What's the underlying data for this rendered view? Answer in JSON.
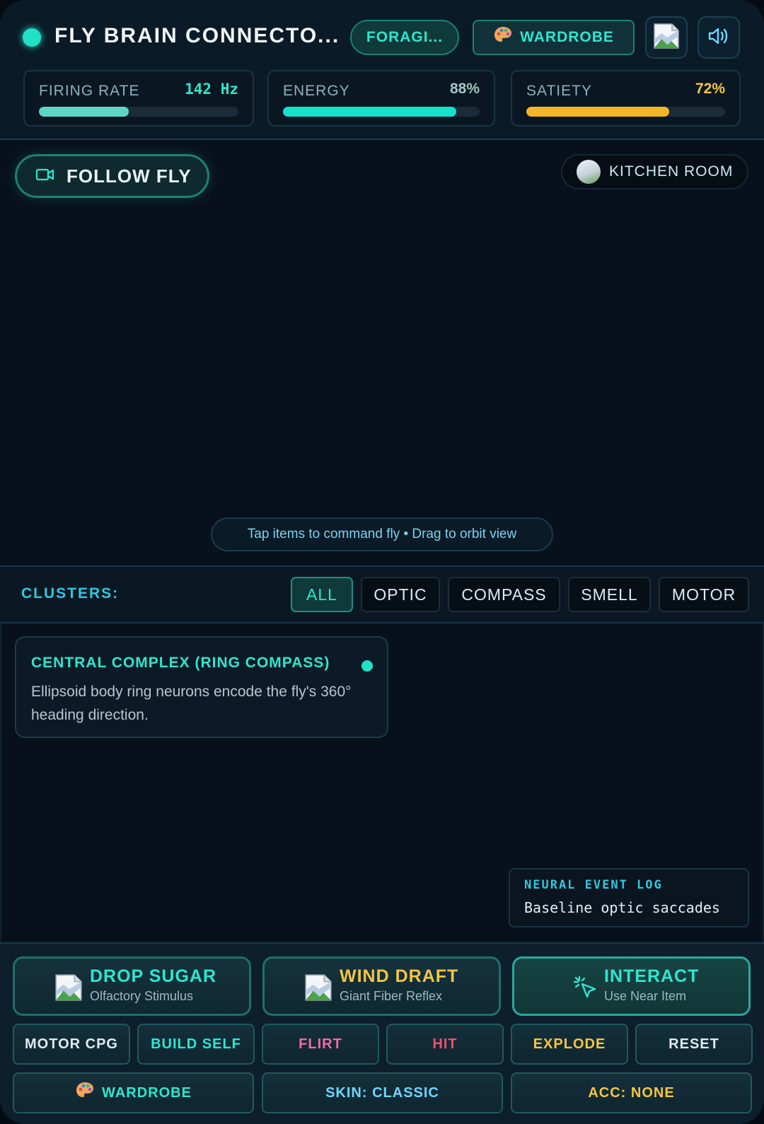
{
  "header": {
    "title": "FLY BRAIN CONNECTO...",
    "mode_label": "FORAGI...",
    "wardrobe_label": "WARDROBE",
    "icons": [
      "palette-icon",
      "image-placeholder-icon",
      "speaker-icon"
    ]
  },
  "stats": [
    {
      "label": "FIRING RATE",
      "value": "142 Hz",
      "level": 0.45,
      "color": "#5fd6c4"
    },
    {
      "label": "ENERGY",
      "value": "88%",
      "level": 0.88,
      "color": "#16e2cc"
    },
    {
      "label": "SATIETY",
      "value": "72%",
      "level": 0.72,
      "color": "#f4b527"
    }
  ],
  "viewport": {
    "follow_label": "FOLLOW FLY",
    "room_label": "KITCHEN ROOM",
    "hint": "Tap items to command fly • Drag to orbit view"
  },
  "clusters": {
    "label": "CLUSTERS:",
    "tabs": [
      "ALL",
      "OPTIC",
      "COMPASS",
      "SMELL",
      "MOTOR"
    ],
    "active": "ALL"
  },
  "info": {
    "title": "CENTRAL COMPLEX (RING COMPASS)",
    "description": "Ellipsoid body ring neurons encode the fly's 360° heading direction."
  },
  "log": {
    "title": "NEURAL EVENT LOG",
    "line": "Baseline optic saccades"
  },
  "actions": {
    "primary": [
      {
        "title": "DROP SUGAR",
        "subtitle": "Olfactory Stimulus",
        "color": "#2ee6cf"
      },
      {
        "title": "WIND DRAFT",
        "subtitle": "Giant Fiber Reflex",
        "color": "#f4c542"
      },
      {
        "title": "INTERACT",
        "subtitle": "Use Near Item",
        "color": "#2ee6cf"
      }
    ],
    "secondary": [
      {
        "label": "MOTOR CPG",
        "color": "#dfeaf0"
      },
      {
        "label": "BUILD SELF",
        "color": "#2ee6cf"
      },
      {
        "label": "FLIRT",
        "color": "#f06aa8"
      },
      {
        "label": "HIT",
        "color": "#f0506a"
      },
      {
        "label": "EXPLODE",
        "color": "#f4c542"
      },
      {
        "label": "RESET",
        "color": "#dfeaf0"
      }
    ],
    "wardrobe_label": "WARDROBE",
    "skin_label": "SKIN: CLASSIC",
    "acc_label": "ACC: NONE"
  }
}
